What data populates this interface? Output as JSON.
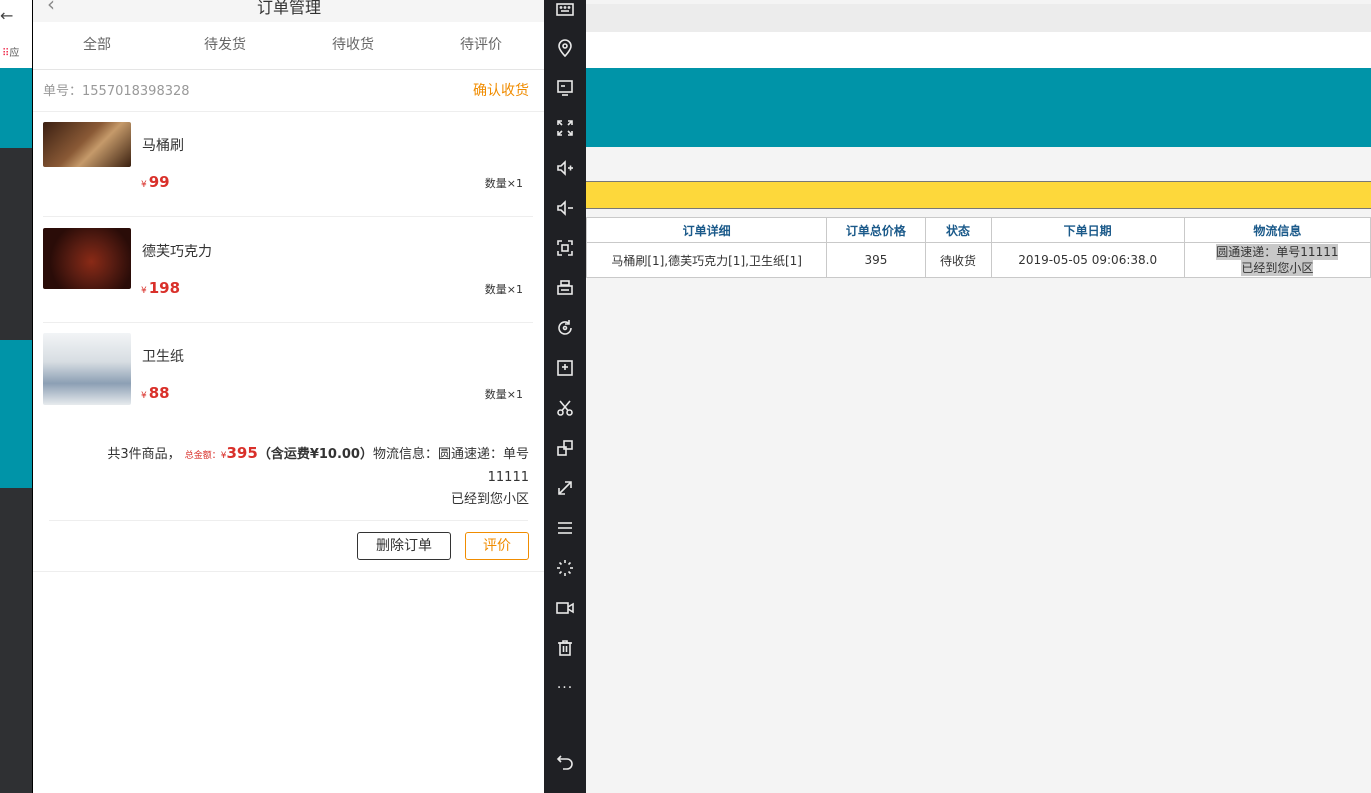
{
  "browser": {
    "back_glyph": "←",
    "apps_label": "应"
  },
  "phone": {
    "nav_title": "订单管理",
    "nav_back": "‹",
    "tabs": [
      {
        "label": "全部"
      },
      {
        "label": "待发货"
      },
      {
        "label": "待收货"
      },
      {
        "label": "待评价"
      }
    ],
    "order": {
      "order_no": "单号：1557018398328",
      "confirm_label": "确认收货",
      "items": [
        {
          "name": "马桶刷",
          "currency": "¥",
          "price": "99",
          "qty": "数量×1",
          "thumb_color": "#7a4a2a"
        },
        {
          "name": "德芙巧克力",
          "currency": "¥",
          "price": "198",
          "qty": "数量×1",
          "thumb_color": "#5a1d12"
        },
        {
          "name": "卫生纸",
          "currency": "¥",
          "price": "88",
          "qty": "数量×1",
          "thumb_color": "#b9c4cc"
        }
      ],
      "summary": {
        "count_text": "共3件商品，",
        "total_label": "总金额：¥",
        "total_value": "395",
        "shipping_text": "（含运费¥10.00）",
        "logistics_text": "物流信息：圆通速递：单号11111",
        "logistics_line2": "已经到您小区"
      },
      "delete_label": "删除订单",
      "rate_label": "评价"
    }
  },
  "toolbar": {
    "icons": [
      "keyboard-icon",
      "location-icon",
      "screen-icon",
      "fullscreen-icon",
      "volume-up-icon",
      "volume-down-icon",
      "screenshot-icon",
      "print-icon",
      "rotate-icon",
      "add-apk-icon",
      "scissors-icon",
      "multi-window-icon",
      "resize-icon",
      "menu-icon",
      "loading-icon",
      "record-video-icon",
      "trash-icon",
      "more-icon",
      "return-icon"
    ],
    "more_glyph": "···"
  },
  "web": {
    "table": {
      "headers": [
        "订单详细",
        "订单总价格",
        "状态",
        "下单日期",
        "物流信息"
      ],
      "rows": [
        [
          "马桶刷[1],德芙巧克力[1],卫生纸[1]",
          "395",
          "待收货",
          "2019-05-05 09:06:38.0",
          "圆通速递：单号11111"
        ]
      ],
      "logistics_line2": "已经到您小区"
    }
  },
  "colors": {
    "accent_orange": "#f08c00",
    "price_red": "#d9302a",
    "teal": "#0094a8",
    "yellow": "#fdd83b"
  }
}
